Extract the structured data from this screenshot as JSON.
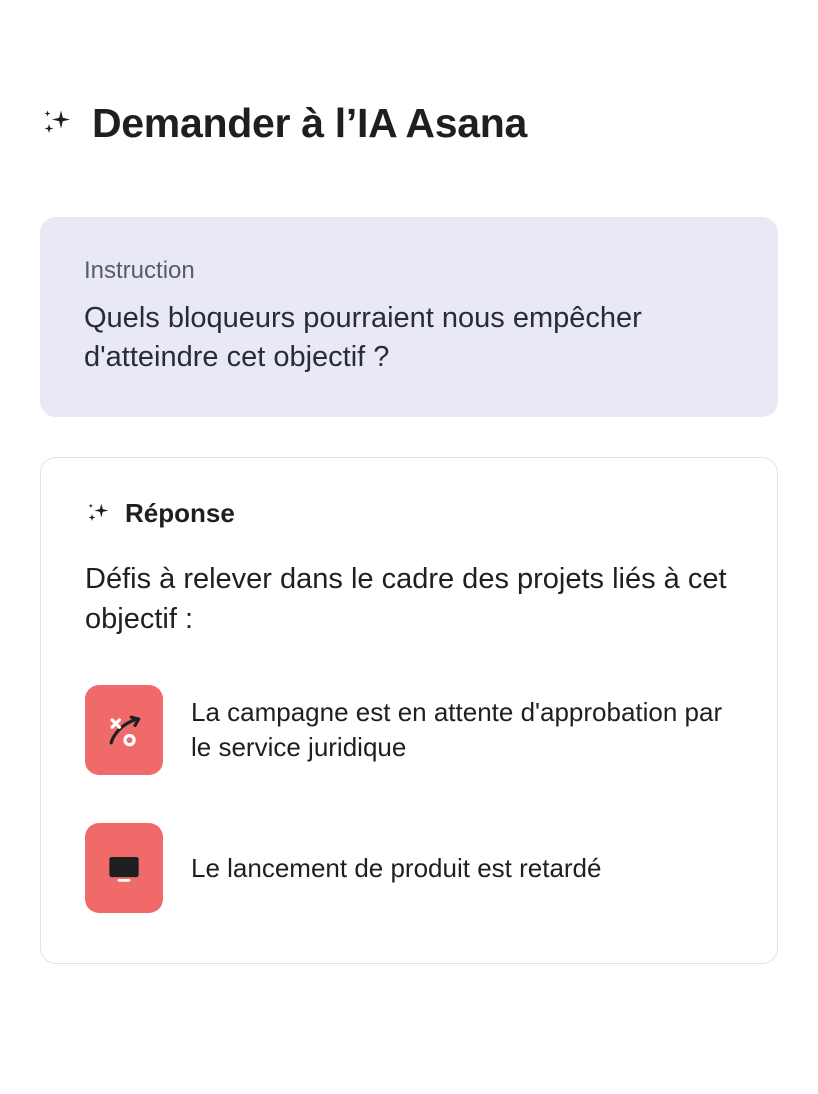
{
  "header": {
    "title": "Demander à l’IA Asana"
  },
  "instruction": {
    "label": "Instruction",
    "text": "Quels bloqueurs pourraient nous empêcher d'atteindre cet objectif ?"
  },
  "response": {
    "label": "Réponse",
    "summary": "Défis à relever dans le cadre des projets liés à cet objectif :",
    "items": [
      {
        "icon": "path-blocked-icon",
        "text": "La campagne est en attente d'approbation par le service juridique"
      },
      {
        "icon": "monitor-icon",
        "text": "Le lancement de produit est retardé"
      }
    ]
  },
  "colors": {
    "instruction_bg": "#e8e8f6",
    "challenge_icon_bg": "#f06a6a",
    "text_primary": "#1e1f21",
    "text_secondary": "#5a5b6a"
  }
}
